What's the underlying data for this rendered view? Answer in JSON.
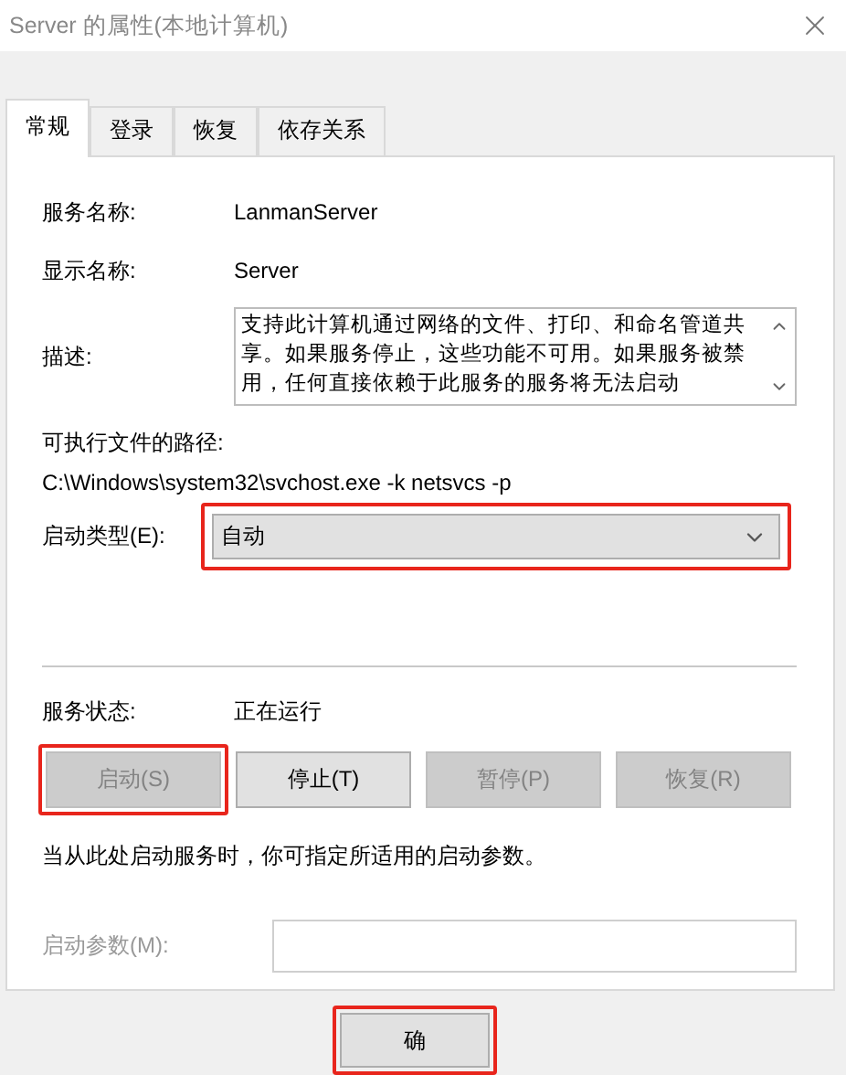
{
  "window": {
    "title": "Server 的属性(本地计算机)"
  },
  "tabs": [
    {
      "label": "常规",
      "selected": true
    },
    {
      "label": "登录",
      "selected": false
    },
    {
      "label": "恢复",
      "selected": false
    },
    {
      "label": "依存关系",
      "selected": false
    }
  ],
  "service_name": {
    "label": "服务名称:",
    "value": "LanmanServer"
  },
  "display_name": {
    "label": "显示名称:",
    "value": "Server"
  },
  "description": {
    "label": "描述:",
    "value": "支持此计算机通过网络的文件、打印、和命名管道共享。如果服务停止，这些功能不可用。如果服务被禁用，任何直接依赖于此服务的服务将无法启动"
  },
  "executable_path": {
    "label": "可执行文件的路径:",
    "value": "C:\\Windows\\system32\\svchost.exe -k netsvcs -p"
  },
  "startup_type": {
    "label": "启动类型(E):",
    "value": "自动",
    "highlighted": true
  },
  "service_status": {
    "label": "服务状态:",
    "value": "正在运行"
  },
  "service_buttons": [
    {
      "label": "启动(S)",
      "disabled": true,
      "highlighted": true
    },
    {
      "label": "停止(T)",
      "disabled": false,
      "highlighted": false
    },
    {
      "label": "暂停(P)",
      "disabled": true,
      "highlighted": false
    },
    {
      "label": "恢复(R)",
      "disabled": true,
      "highlighted": false
    }
  ],
  "hint": "当从此处启动服务时，你可指定所适用的启动参数。",
  "start_parameters": {
    "label": "启动参数(M):",
    "disabled": true
  },
  "footer_buttons": [
    {
      "label": "确",
      "disabled": false,
      "highlighted": true
    }
  ]
}
